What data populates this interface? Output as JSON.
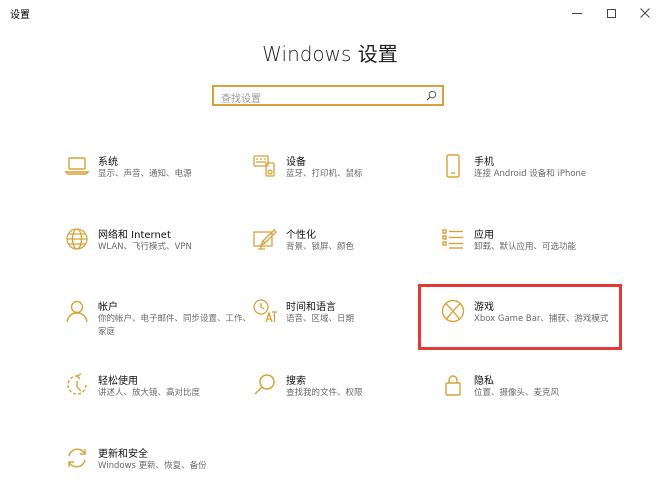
{
  "window": {
    "title": "设置"
  },
  "header": {
    "title": "Windows 设置"
  },
  "search": {
    "placeholder": "查找设置"
  },
  "tiles": [
    {
      "title": "系统",
      "desc": "显示、声音、通知、电源",
      "icon": "laptop-icon"
    },
    {
      "title": "设备",
      "desc": "蓝牙、打印机、鼠标",
      "icon": "devices-icon"
    },
    {
      "title": "手机",
      "desc": "连接 Android 设备和 iPhone",
      "icon": "phone-icon"
    },
    {
      "title": "网络和 Internet",
      "desc": "WLAN、飞行模式、VPN",
      "icon": "globe-icon"
    },
    {
      "title": "个性化",
      "desc": "背景、锁屏、颜色",
      "icon": "paintbrush-icon"
    },
    {
      "title": "应用",
      "desc": "卸载、默认应用、可选功能",
      "icon": "apps-list-icon"
    },
    {
      "title": "帐户",
      "desc": "你的帐户、电子邮件、同步设置、工作、家庭",
      "icon": "person-icon"
    },
    {
      "title": "时间和语言",
      "desc": "语音、区域、日期",
      "icon": "time-language-icon"
    },
    {
      "title": "游戏",
      "desc": "Xbox Game Bar、捕获、游戏模式",
      "icon": "xbox-icon"
    },
    {
      "title": "轻松使用",
      "desc": "讲述人、放大镜、高对比度",
      "icon": "ease-of-access-icon"
    },
    {
      "title": "搜索",
      "desc": "查找我的文件、权限",
      "icon": "search-icon"
    },
    {
      "title": "隐私",
      "desc": "位置、摄像头、麦克风",
      "icon": "lock-icon"
    },
    {
      "title": "更新和安全",
      "desc": "Windows 更新、恢复、备份",
      "icon": "update-icon"
    }
  ],
  "colors": {
    "accent": "#d9a13a",
    "highlight": "#e53935"
  }
}
